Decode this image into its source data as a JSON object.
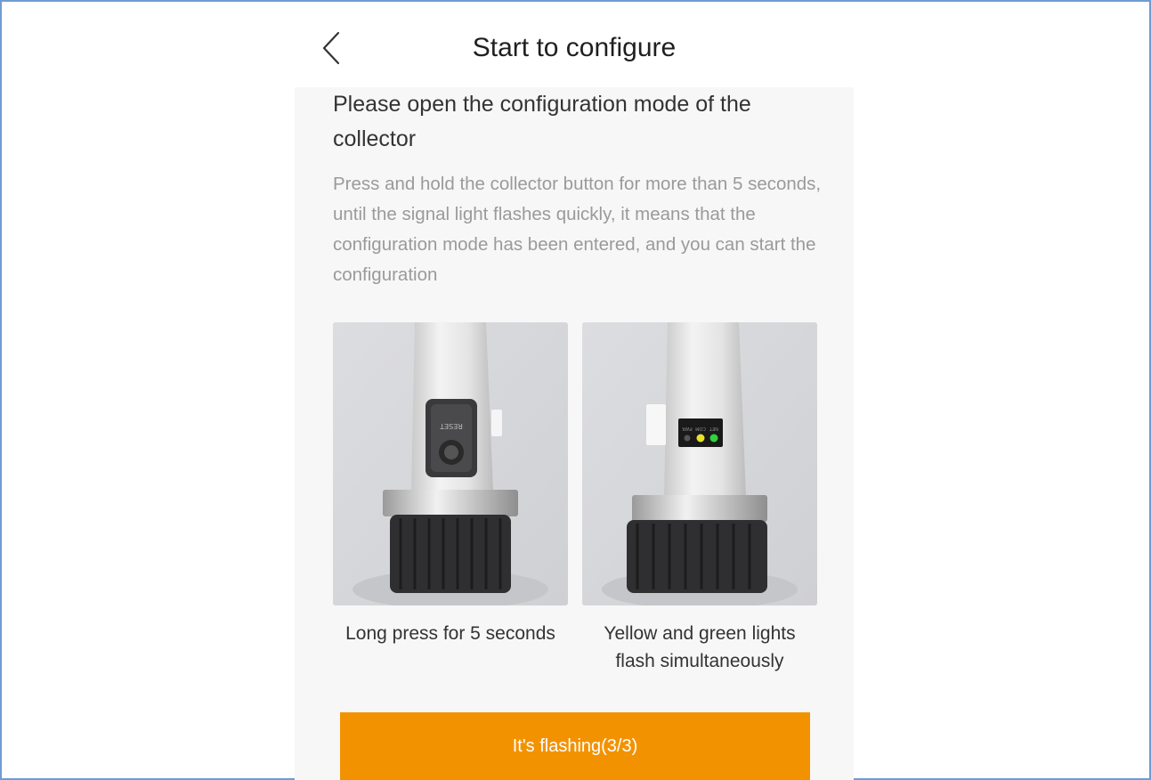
{
  "header": {
    "title": "Start to configure",
    "back_icon": "chevron-left-icon"
  },
  "content": {
    "heading": "Please open the configuration mode of the collector",
    "instructions": "Press and hold the collector button for more than 5 seconds, until the signal light flashes quickly, it means that the configuration mode has been entered, and you can start the configuration",
    "images": [
      {
        "caption": "Long press for 5 seconds",
        "button_label": "RESET"
      },
      {
        "caption": "Yellow and green lights flash simultaneously",
        "indicator_labels": [
          "PWR",
          "COM",
          "NET"
        ]
      }
    ],
    "confirm_button": "It's flashing(3/3)"
  },
  "colors": {
    "accent": "#f39200",
    "frame": "#6f9bd1",
    "yellow_light": "#e8e22a",
    "green_light": "#2fd23a"
  }
}
